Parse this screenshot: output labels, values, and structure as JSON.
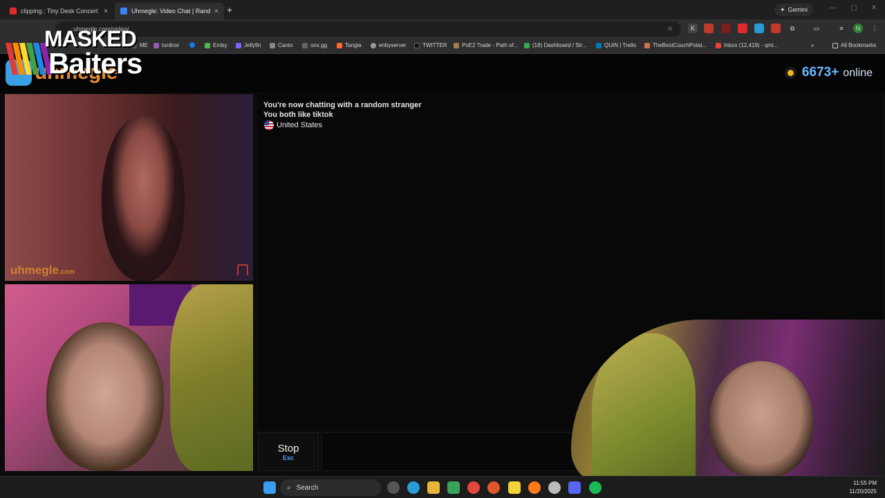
{
  "browser": {
    "tabs": [
      {
        "title": "clipping.: Tiny Desk Concert - Y",
        "close": "×",
        "color": "#e02b2b"
      },
      {
        "title": "Uhmegle: Video Chat | Rand",
        "close": "×",
        "color": "#3b82f6",
        "active": true
      }
    ],
    "new_tab": "+",
    "gemini_label": "Gemini",
    "address": "uhmegle.com/video/",
    "bookmarks": [
      {
        "label": "ME",
        "color": "#555"
      },
      {
        "label": "turdnor",
        "color": "#9b59b6"
      },
      {
        "label": "",
        "color": "#1877f2"
      },
      {
        "label": "Emby",
        "color": "#52b54b"
      },
      {
        "label": "Jellyfin",
        "color": "#7b61ff"
      },
      {
        "label": "Canto",
        "color": "#888"
      },
      {
        "label": "onx.gg",
        "color": "#666"
      },
      {
        "label": "Tangia",
        "color": "#ff6a2b"
      },
      {
        "label": "enbyserver",
        "color": "#999"
      },
      {
        "label": "TWITTER",
        "color": "#111"
      },
      {
        "label": "PoE2 Trade - Path of...",
        "color": "#a67c52"
      },
      {
        "label": "(18) Dashboard / Str...",
        "color": "#35a853"
      },
      {
        "label": "QUIN | Trello",
        "color": "#0079bf"
      },
      {
        "label": "TheBestCouchPotat...",
        "color": "#c9744a"
      },
      {
        "label": "Inbox (12,419) - qmi...",
        "color": "#ea4335"
      }
    ],
    "all_bookmarks": "All Bookmarks",
    "more_bookmarks": "»"
  },
  "site": {
    "logo_text": "uhmegle",
    "online_count": "6673+",
    "online_label": "online",
    "online_dot_color": "#f2b21b"
  },
  "watermark_logo": {
    "line1": "MASKED",
    "line2": "Baiters"
  },
  "video": {
    "watermark": "uhmegle",
    "watermark_suffix": ".com"
  },
  "chat": {
    "line1": "You're now chatting with a random stranger",
    "line2": "You both like tiktok",
    "country": "United States"
  },
  "controls": {
    "stop_label": "Stop",
    "stop_key": "Esc"
  },
  "taskbar": {
    "search_label": "Search",
    "time": "11:55 PM",
    "date": "11/20/2025",
    "apps": [
      {
        "name": "start-icon",
        "color": "#3a9df0"
      },
      {
        "name": "task-view-icon",
        "color": "#666"
      },
      {
        "name": "edge-icon",
        "color": "#2a9bd6"
      },
      {
        "name": "file-explorer-icon",
        "color": "#e8b43a"
      },
      {
        "name": "app-icon",
        "color": "#3aa35a"
      },
      {
        "name": "chrome-icon",
        "color": "#e5483a"
      },
      {
        "name": "app-icon-2",
        "color": "#e0572a"
      },
      {
        "name": "sticky-notes-icon",
        "color": "#f1d33a"
      },
      {
        "name": "firefox-icon",
        "color": "#ff7a1a"
      },
      {
        "name": "app-icon-3",
        "color": "#bbb"
      },
      {
        "name": "discord-icon",
        "color": "#5865f2"
      },
      {
        "name": "spotify-icon",
        "color": "#1db954"
      }
    ]
  }
}
